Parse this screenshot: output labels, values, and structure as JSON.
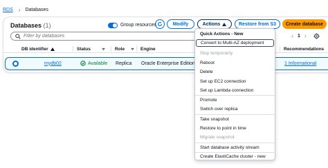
{
  "breadcrumb": {
    "root": "RDS",
    "separator": "›",
    "current": "Databases"
  },
  "header": {
    "title": "Databases",
    "count": "(1)"
  },
  "toggle": {
    "label": "Group resources",
    "on": true
  },
  "buttons": {
    "modify": "Modify",
    "actions": "Actions",
    "restore": "Restore from S3",
    "create": "Create database"
  },
  "search": {
    "placeholder": "Filter by databases"
  },
  "pager": {
    "prev": "‹",
    "page": "1",
    "next": "›"
  },
  "table": {
    "columns": [
      "DB identifier",
      "Status",
      "Role",
      "Engine",
      "Recommendations"
    ],
    "row": {
      "id": "mydb02",
      "status": "Available",
      "role": "Replica",
      "engine": "Oracle Enterprise Edition",
      "recommendation": "1 Informational"
    }
  },
  "menu": {
    "items": [
      {
        "label": "Quick Actions - New",
        "state": "bold"
      },
      {
        "label": "Convert to Multi-AZ deployment",
        "state": "hover"
      },
      {
        "label": "Stop temporarily",
        "state": "disabled"
      },
      {
        "label": "Reboot",
        "state": "normal"
      },
      {
        "label": "Delete",
        "state": "normal"
      },
      {
        "label": "Set up EC2 connection",
        "state": "normal"
      },
      {
        "label": "Set up Lambda connection",
        "state": "normal"
      },
      {
        "label": "Promote",
        "state": "normal"
      },
      {
        "label": "Switch over replica",
        "state": "normal"
      },
      {
        "label": "Take snapshot",
        "state": "normal"
      },
      {
        "label": "Restore to point in time",
        "state": "normal"
      },
      {
        "label": "Migrate snapshot",
        "state": "disabled"
      },
      {
        "label": "Start database activity stream",
        "state": "normal"
      },
      {
        "label": "Create ElastiCache cluster - new",
        "state": "normal"
      }
    ]
  },
  "colors": {
    "link": "#006ce0",
    "primary": "#ff9900",
    "success": "#00802f",
    "row_selected": "#f0fbff"
  }
}
